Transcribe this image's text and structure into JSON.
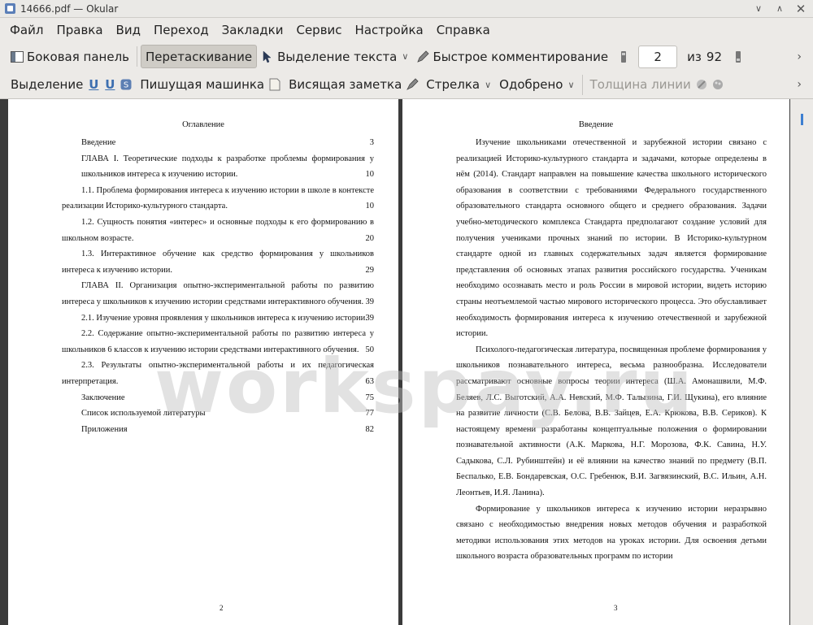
{
  "window": {
    "title": "14666.pdf — Okular"
  },
  "menubar": [
    "Файл",
    "Правка",
    "Вид",
    "Переход",
    "Закладки",
    "Сервис",
    "Настройка",
    "Справка"
  ],
  "toolbar1": {
    "sidebar": "Боковая панель",
    "drag": "Перетаскивание",
    "text_select": "Выделение текста",
    "quick_annot": "Быстрое комментирование",
    "page_current": "2",
    "page_of": "из",
    "page_total": "92"
  },
  "toolbar2": {
    "selection": "Выделение",
    "typewriter": "Пишущая машинка",
    "sticky": "Висящая заметка",
    "arrow": "Стрелка",
    "approved": "Одобрено",
    "line_width": "Толщина линии"
  },
  "page1": {
    "heading": "Оглавление",
    "toc": [
      {
        "text": "Введение",
        "page": "3"
      },
      {
        "text": "ГЛАВА I. Теоретические подходы к разработке проблемы формирования у школьников интереса к изучению истории.",
        "page": "10"
      },
      {
        "text": "1.1. Проблема формирования интереса к изучению истории в школе в контексте реализации Историко-культурного стандарта.",
        "page": "10"
      },
      {
        "text": "1.2. Сущность понятия «интерес» и основные подходы к его формированию в школьном возрасте.",
        "page": "20"
      },
      {
        "text": "1.3. Интерактивное обучение как средство формирования у школьников интереса к изучению истории.",
        "page": "29"
      },
      {
        "text": "ГЛАВА II. Организация опытно-экспериментальной работы по развитию интереса у школьников к изучению истории средствами интерактивного обучения.",
        "page": "39"
      },
      {
        "text": "2.1. Изучение уровня проявления у школьников интереса к изучению истории.",
        "page": "39"
      },
      {
        "text": "2.2. Содержание опытно-экспериментальной работы по развитию интереса у школьников 6 классов к изучению истории средствами интерактивного обучения.",
        "page": "50"
      },
      {
        "text": "2.3. Результаты опытно-экспериментальной работы и их педагогическая интерпретация.",
        "page": "63"
      },
      {
        "text": "Заключение",
        "page": "75"
      },
      {
        "text": "Список используемой литературы",
        "page": "77"
      },
      {
        "text": "Приложения",
        "page": "82"
      }
    ],
    "number": "2"
  },
  "page2": {
    "heading": "Введение",
    "paragraphs": [
      "Изучение школьниками отечественной и зарубежной истории связано с реализацией Историко-культурного стандарта и задачами, которые определены в нём (2014). Стандарт направлен на повышение качества школьного исторического образования в соответствии с требованиями Федерального государственного образовательного стандарта основного общего и среднего образования. Задачи учебно-методического комплекса Стандарта предполагают создание условий для получения учениками прочных знаний по истории. В Историко-культурном стандарте одной из главных содержательных задач является формирование представления об основных этапах развития российского государства. Ученикам необходимо осознавать место и роль России в мировой истории, видеть историю страны неотъемлемой частью мирового исторического процесса. Это обуславливает необходимость формирования интереса к изучению отечественной и зарубежной истории.",
      "Психолого-педагогическая литература, посвященная проблеме формирования у школьников познавательного интереса, весьма разнообразна. Исследователи рассматривают основные вопросы теории интереса (Ш.А. Амонашвили, М.Ф. Беляев, Л.С. Выготский, А.А. Невский, М.Ф. Талызина, Г.И. Щукина), его влияние на развитие личности (С.В. Белова, В.В. Зайцев, Е.А. Крюкова, В.В. Сериков). К настоящему времени разработаны концептуальные положения о формировании познавательной активности (А.К. Маркова, Н.Г. Морозова, Ф.К. Савина, Н.У. Садыкова, С.Л. Рубинштейн) и её влиянии на качество знаний по предмету (В.П. Беспалько, Е.В. Бондаревская, О.С. Гребенюк, В.И. Загвязинский, В.С. Ильин, А.Н. Леонтьев, И.Я. Ланина).",
      "Формирование у школьников интереса к изучению истории неразрывно связано с необходимостью внедрения новых методов обучения и разработкой методики использования этих методов на уроках истории. Для освоения детьми школьного возраста образовательных программ по истории"
    ],
    "number": "3"
  },
  "watermark": "workspay.ru"
}
